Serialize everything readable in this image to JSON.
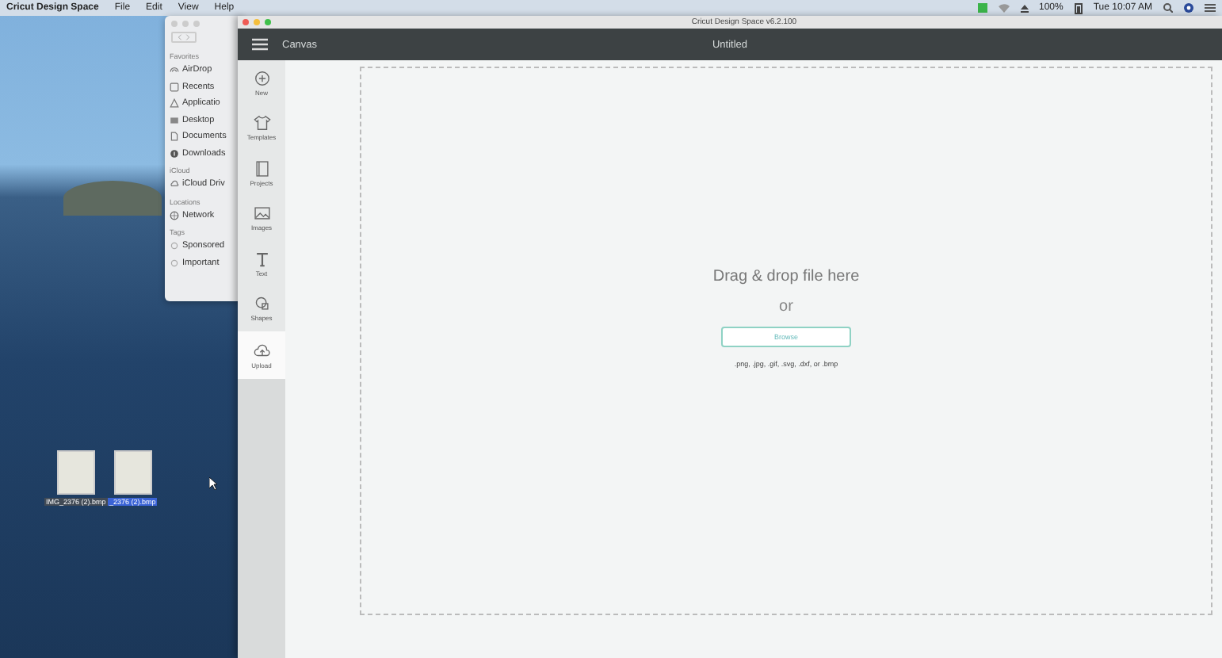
{
  "menu_bar": {
    "app_name": "Cricut Design Space",
    "menus": [
      "File",
      "Edit",
      "View",
      "Help"
    ],
    "battery": "100%",
    "clock": "Tue 10:07 AM"
  },
  "finder": {
    "sections": [
      {
        "title": "Favorites",
        "items": [
          {
            "label": "AirDrop"
          },
          {
            "label": "Recents"
          },
          {
            "label": "Applicatio"
          },
          {
            "label": "Desktop"
          },
          {
            "label": "Documents"
          },
          {
            "label": "Downloads"
          }
        ]
      },
      {
        "title": "iCloud",
        "items": [
          {
            "label": "iCloud Driv"
          }
        ]
      },
      {
        "title": "Locations",
        "items": [
          {
            "label": "Network"
          }
        ]
      },
      {
        "title": "Tags",
        "items": [
          {
            "label": "Sponsored"
          },
          {
            "label": "Important"
          }
        ]
      }
    ]
  },
  "desktop_files": [
    {
      "label": "IMG_2376 (2).bmp",
      "selected": false
    },
    {
      "label": "_2376 (2).bmp",
      "selected": true
    }
  ],
  "cricut": {
    "window_title": "Cricut Design Space v6.2.100",
    "header": {
      "section": "Canvas",
      "document": "Untitled"
    },
    "tools": [
      {
        "label": "New",
        "selected": false
      },
      {
        "label": "Templates",
        "selected": false
      },
      {
        "label": "Projects",
        "selected": false
      },
      {
        "label": "Images",
        "selected": false
      },
      {
        "label": "Text",
        "selected": false
      },
      {
        "label": "Shapes",
        "selected": false
      },
      {
        "label": "Upload",
        "selected": true
      }
    ],
    "drop_zone": {
      "heading": "Drag & drop file here",
      "separator": "or",
      "button": "Browse",
      "formats": ".png, .jpg, .gif, .svg, .dxf, or .bmp"
    }
  }
}
